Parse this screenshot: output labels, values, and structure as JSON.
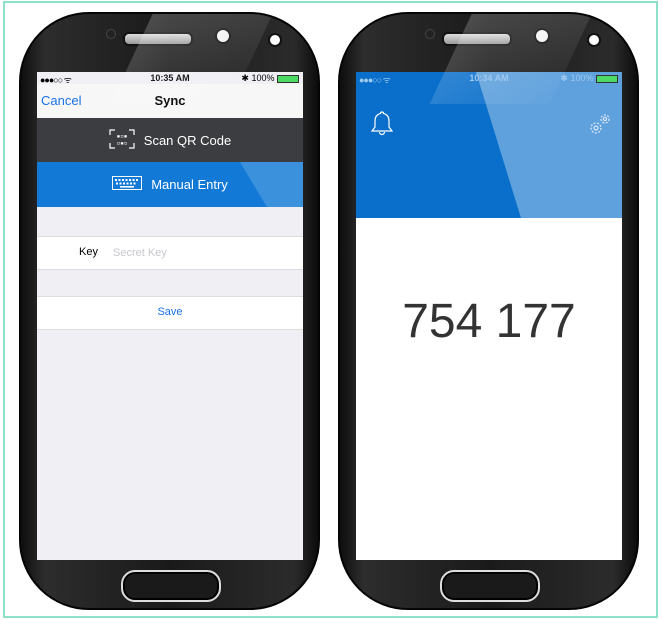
{
  "left_screen": {
    "status": {
      "signal": "●●●○○ ᯤ",
      "time": "10:35 AM",
      "battery": "✱ 100%"
    },
    "nav": {
      "cancel": "Cancel",
      "title": "Sync"
    },
    "scan_option": {
      "label": "Scan QR Code",
      "icon": "qr-code-icon"
    },
    "manual_option": {
      "label": "Manual Entry",
      "icon": "keyboard-icon"
    },
    "key_field": {
      "label": "Key",
      "placeholder": "Secret Key",
      "value": ""
    },
    "save_label": "Save"
  },
  "right_screen": {
    "status": {
      "signal": "●●●○○ ᯤ",
      "time": "10:34 AM",
      "battery": "✱ 100%"
    },
    "code": "754 177",
    "icons": [
      "bell-icon",
      "settings-gears-icon"
    ]
  },
  "colors": {
    "accent_blue": "#1279d6",
    "header_blue": "#0a6fcb",
    "dark_option": "#3b3d40",
    "link_blue": "#1a73e8",
    "frame": "#8fe0c8"
  }
}
